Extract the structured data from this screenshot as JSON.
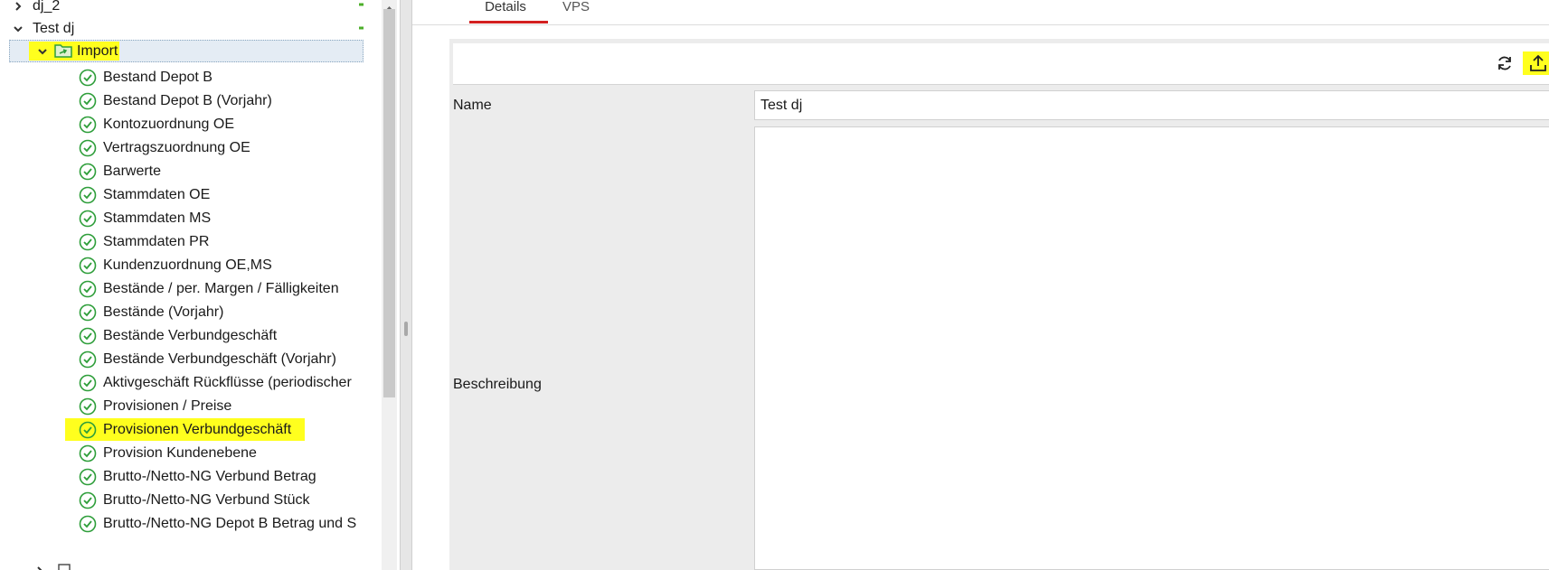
{
  "tree": {
    "top_node": "dj_2",
    "group_node": "Test dj",
    "import_node": "Import",
    "items": [
      "Bestand Depot B",
      "Bestand Depot B (Vorjahr)",
      "Kontozuordnung OE",
      "Vertragszuordnung OE",
      "Barwerte",
      "Stammdaten OE",
      "Stammdaten MS",
      "Stammdaten PR",
      "Kundenzuordnung OE,MS",
      "Bestände / per. Margen / Fälligkeiten",
      "Bestände (Vorjahr)",
      "Bestände Verbundgeschäft",
      "Bestände Verbundgeschäft (Vorjahr)",
      "Aktivgeschäft Rückflüsse (periodischer",
      "Provisionen / Preise",
      "Provisionen Verbundgeschäft",
      "Provision Kundenebene",
      "Brutto-/Netto-NG Verbund Betrag",
      "Brutto-/Netto-NG Verbund Stück",
      "Brutto-/Netto-NG Depot B Betrag und S"
    ],
    "highlighted_item": "Provisionen Verbundgeschäft"
  },
  "tabs": [
    "Details",
    "VPS"
  ],
  "active_tab": "Details",
  "toolbar": {
    "icons": [
      "refresh-icon",
      "upload-icon",
      "copy-icon"
    ],
    "highlighted_icon": "upload-icon"
  },
  "form": {
    "name_label": "Name",
    "name_value": "Test dj",
    "description_label": "Beschreibung",
    "description_value": ""
  },
  "colors": {
    "highlight": "#ffff1e",
    "check_green": "#2e9e3a",
    "plus_green": "#4caf2a",
    "tab_underline": "#d32020"
  }
}
